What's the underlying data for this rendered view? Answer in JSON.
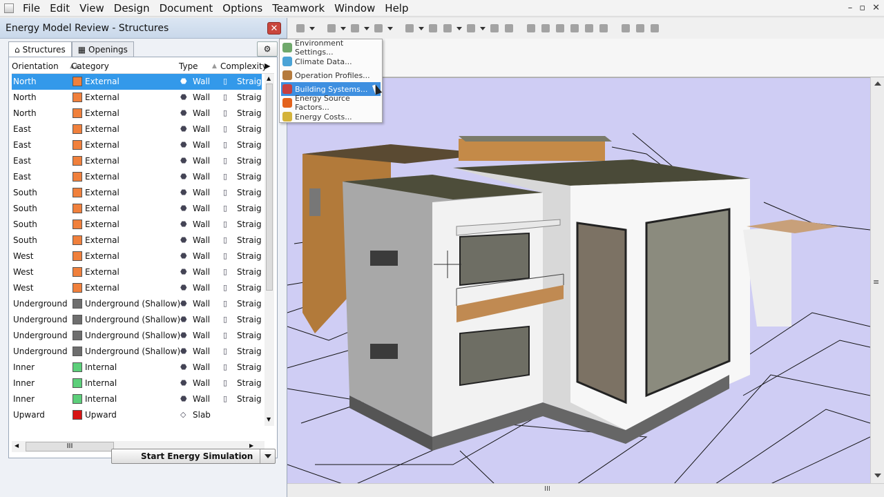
{
  "menubar": {
    "items": [
      "File",
      "Edit",
      "View",
      "Design",
      "Document",
      "Options",
      "Teamwork",
      "Window",
      "Help"
    ],
    "minimize": "–",
    "restore": "▫",
    "close": "✕"
  },
  "palette": {
    "title": "Energy Model Review - Structures",
    "close_glyph": "✕",
    "tabs": [
      {
        "label": "Structures",
        "active": true
      },
      {
        "label": "Openings",
        "active": false
      }
    ],
    "columns": [
      "Orientation",
      "Category",
      "Type",
      "Complexity"
    ],
    "rows": [
      {
        "orientation": "North",
        "category": "External",
        "color": "#f0803c",
        "type": "Wall",
        "complexity": "Straigh",
        "selected": true
      },
      {
        "orientation": "North",
        "category": "External",
        "color": "#f0803c",
        "type": "Wall",
        "complexity": "Straigh"
      },
      {
        "orientation": "North",
        "category": "External",
        "color": "#f0803c",
        "type": "Wall",
        "complexity": "Straigh"
      },
      {
        "orientation": "East",
        "category": "External",
        "color": "#f0803c",
        "type": "Wall",
        "complexity": "Straigh"
      },
      {
        "orientation": "East",
        "category": "External",
        "color": "#f0803c",
        "type": "Wall",
        "complexity": "Straigh"
      },
      {
        "orientation": "East",
        "category": "External",
        "color": "#f0803c",
        "type": "Wall",
        "complexity": "Straigh"
      },
      {
        "orientation": "East",
        "category": "External",
        "color": "#f0803c",
        "type": "Wall",
        "complexity": "Straigh"
      },
      {
        "orientation": "South",
        "category": "External",
        "color": "#f0803c",
        "type": "Wall",
        "complexity": "Straigh"
      },
      {
        "orientation": "South",
        "category": "External",
        "color": "#f0803c",
        "type": "Wall",
        "complexity": "Straigh"
      },
      {
        "orientation": "South",
        "category": "External",
        "color": "#f0803c",
        "type": "Wall",
        "complexity": "Straigh"
      },
      {
        "orientation": "South",
        "category": "External",
        "color": "#f0803c",
        "type": "Wall",
        "complexity": "Straigh"
      },
      {
        "orientation": "West",
        "category": "External",
        "color": "#f0803c",
        "type": "Wall",
        "complexity": "Straigh"
      },
      {
        "orientation": "West",
        "category": "External",
        "color": "#f0803c",
        "type": "Wall",
        "complexity": "Straigh"
      },
      {
        "orientation": "West",
        "category": "External",
        "color": "#f0803c",
        "type": "Wall",
        "complexity": "Straigh"
      },
      {
        "orientation": "Underground",
        "category": "Underground (Shallow)",
        "color": "#6e6e6e",
        "type": "Wall",
        "complexity": "Straigh"
      },
      {
        "orientation": "Underground",
        "category": "Underground (Shallow)",
        "color": "#6e6e6e",
        "type": "Wall",
        "complexity": "Straigh"
      },
      {
        "orientation": "Underground",
        "category": "Underground (Shallow)",
        "color": "#6e6e6e",
        "type": "Wall",
        "complexity": "Straigh"
      },
      {
        "orientation": "Underground",
        "category": "Underground (Shallow)",
        "color": "#6e6e6e",
        "type": "Wall",
        "complexity": "Straigh"
      },
      {
        "orientation": "Inner",
        "category": "Internal",
        "color": "#5ccf7a",
        "type": "Wall",
        "complexity": "Straigh"
      },
      {
        "orientation": "Inner",
        "category": "Internal",
        "color": "#5ccf7a",
        "type": "Wall",
        "complexity": "Straigh"
      },
      {
        "orientation": "Inner",
        "category": "Internal",
        "color": "#5ccf7a",
        "type": "Wall",
        "complexity": "Straigh"
      },
      {
        "orientation": "Upward",
        "category": "Upward",
        "color": "#d71414",
        "type": "Slab",
        "complexity": ""
      }
    ],
    "hscroll_thumb": "III",
    "sim_button": "Start Energy Simulation"
  },
  "menu": {
    "items": [
      {
        "label": "Environment Settings...",
        "color": "#6fa86b"
      },
      {
        "label": "Climate Data...",
        "color": "#4aa3d6"
      },
      {
        "label": "Operation Profiles...",
        "color": "#b57a3c"
      },
      {
        "label": "Building Systems...",
        "color": "#c74040",
        "hover": true
      },
      {
        "label": "Energy Source Factors...",
        "color": "#e3621c"
      },
      {
        "label": "Energy Costs...",
        "color": "#d4b33a"
      }
    ]
  },
  "viewport": {
    "hscroll_thumb": "III",
    "vscroll_thumb": "≡"
  }
}
